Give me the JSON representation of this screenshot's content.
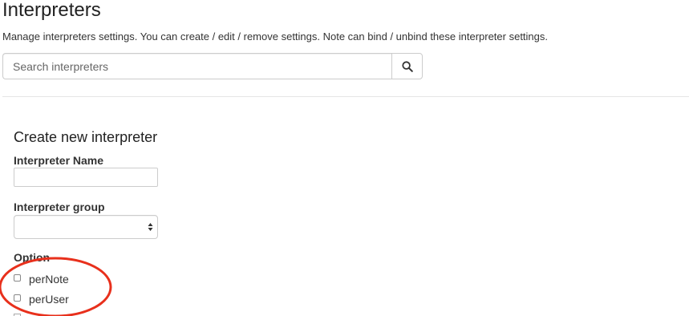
{
  "header": {
    "title": "Interpreters",
    "description": "Manage interpreters settings. You can create / edit / remove settings. Note can bind / unbind these interpreter settings."
  },
  "search": {
    "placeholder": "Search interpreters",
    "value": "",
    "button_icon": "search-icon"
  },
  "create_form": {
    "title": "Create new interpreter",
    "name_label": "Interpreter Name",
    "name_value": "",
    "group_label": "Interpreter group",
    "group_selected": "",
    "option_label": "Option",
    "options": [
      {
        "label": "perNote",
        "checked": false
      },
      {
        "label": "perUser",
        "checked": false
      }
    ]
  },
  "annotation": {
    "shape": "ellipse",
    "color": "#e8301c"
  }
}
